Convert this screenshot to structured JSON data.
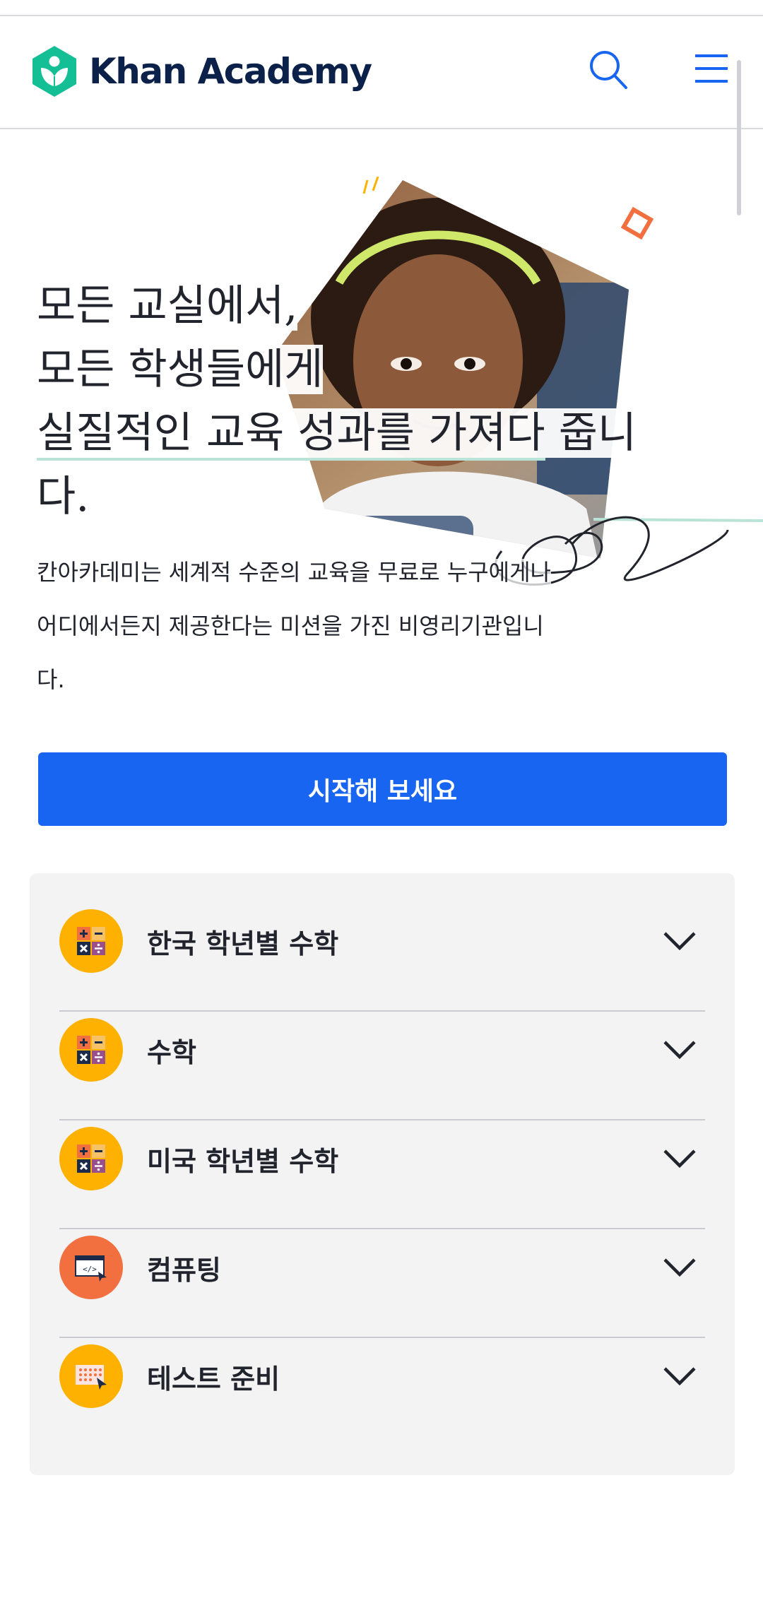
{
  "header": {
    "brand": "Khan Academy",
    "icons": {
      "logo": "khan-leaf-logo",
      "search": "search-icon",
      "menu": "hamburger-menu-icon"
    }
  },
  "hero": {
    "title_line1": "모든 교실에서,",
    "title_line2": "모든 학생들에게",
    "title_line3a": "실질적인 교육 성과를 가져다",
    "title_line3b": " 줍니",
    "title_line4": "다.",
    "description_line1": "칸아카데미는 세계적 수준의 교육을 무료로 누구에게나",
    "description_line2": "어디에서든지 제공한다는 미션을 가진 비영리기관입니",
    "description_line3": "다.",
    "cta_label": "시작해 보세요"
  },
  "subjects": [
    {
      "label": "한국 학년별 수학",
      "icon": "math-symbols-icon",
      "icon_bg": "#ffb100"
    },
    {
      "label": "수학",
      "icon": "math-symbols-icon",
      "icon_bg": "#ffb100"
    },
    {
      "label": "미국 학년별 수학",
      "icon": "math-symbols-icon",
      "icon_bg": "#ffb100"
    },
    {
      "label": "컴퓨팅",
      "icon": "code-window-icon",
      "icon_bg": "#f2703f"
    },
    {
      "label": "테스트 준비",
      "icon": "test-grid-icon",
      "icon_bg": "#ffb100"
    }
  ],
  "colors": {
    "brand_green": "#14bf96",
    "brand_navy": "#0b2149",
    "primary_blue": "#1865f2",
    "accent_orange": "#f2703f",
    "accent_yellow": "#ffb100",
    "underline_mint": "#b9e3d6",
    "panel_gray": "#f3f3f3"
  }
}
